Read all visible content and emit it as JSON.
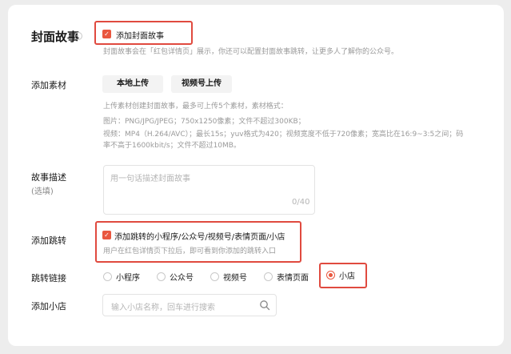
{
  "cover_story": {
    "title": "封面故事",
    "info_icon": "info-icon",
    "checkbox_label": "添加封面故事",
    "checked": true,
    "description": "封面故事会在「红包详情页」展示，你还可以配置封面故事跳转，让更多人了解你的公众号。"
  },
  "material": {
    "label": "添加素材",
    "upload_local": "本地上传",
    "upload_channels": "视频号上传",
    "hint_main": "上传素材创建封面故事，最多可上传5个素材，素材格式：",
    "hint_image": "图片：PNG/JPG/JPEG；750x1250像素；文件不超过300KB；",
    "hint_video_1": "视频：MP4（H.264/AVC）；最长15s；yuv格式为420；视频宽度不低于720像素；宽高比在16:9~3:5之间；码",
    "hint_video_2": "率不高于1600kbit/s；文件不超过10MB。"
  },
  "story_desc": {
    "label": "故事描述",
    "optional": "(选填)",
    "placeholder": "用一句话描述封面故事",
    "counter": "0/40"
  },
  "jump": {
    "label": "添加跳转",
    "checkbox_label": "添加跳转的小程序/公众号/视频号/表情页面/小店",
    "checked": true,
    "hint": "用户在红包详情页下拉后，即可看到你添加的跳转入口"
  },
  "jump_link": {
    "label": "跳转链接",
    "options": [
      "小程序",
      "公众号",
      "视频号",
      "表情页面",
      "小店"
    ],
    "selected": "小店"
  },
  "shop": {
    "label": "添加小店",
    "placeholder": "输入小店名称，回车进行搜索",
    "search_icon": "search-icon"
  },
  "colors": {
    "accent": "#e9573f",
    "highlight": "#e04a3f",
    "background": "#ededed",
    "card": "#ffffff"
  }
}
